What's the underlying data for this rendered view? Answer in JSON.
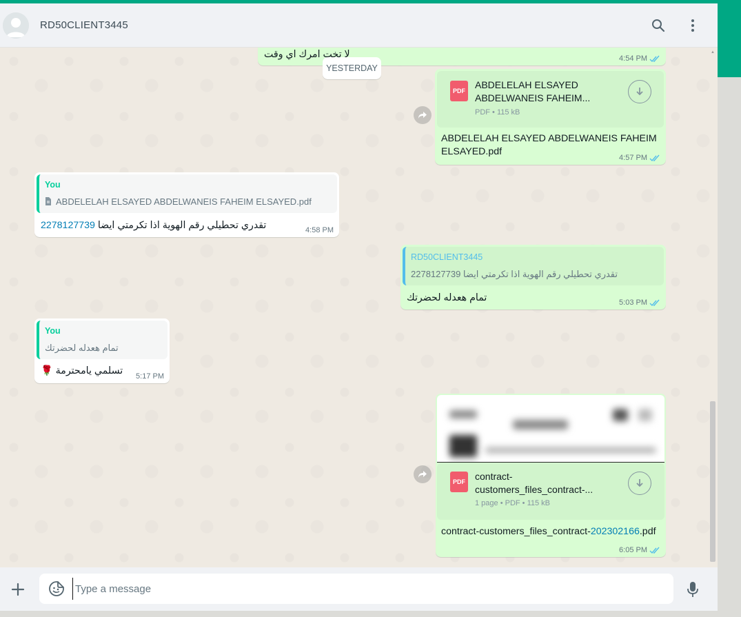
{
  "header": {
    "contact_name": "RD50CLIENT3445",
    "search_icon": "search-icon",
    "menu_icon": "kebab-menu-icon"
  },
  "date_divider": "YESTERDAY",
  "messages": {
    "m0": {
      "text": "لا تخت امرك اي وقت",
      "time": "4:54 PM"
    },
    "m1": {
      "doc_title_line1": "ABDELELAH ELSAYED",
      "doc_title_line2": "ABDELWANEIS FAHEIM...",
      "doc_meta": "PDF • 115 kB",
      "caption_line1": "ABDELELAH ELSAYED ABDELWANEIS FAHEIM",
      "caption_line2": "ELSAYED.pdf",
      "time": "4:57 PM"
    },
    "m2": {
      "quote_author": "You",
      "quote_text": "ABDELELAH ELSAYED ABDELWANEIS FAHEIM ELSAYED.pdf",
      "text": "تقدري تحطيلي رقم الهوية اذا تكرمتي ايضا",
      "number": "2278127739",
      "time": "4:58 PM"
    },
    "m3": {
      "quote_author": "RD50CLIENT3445",
      "quote_text": "تقدري تحطيلي رقم الهوية اذا تكرمتي ايضا 2278127739",
      "text": "تمام هعدله لحضرتك",
      "time": "5:03 PM"
    },
    "m4": {
      "quote_author": "You",
      "quote_text": "تمام هعدله لحضرتك",
      "text": "تسلمي يامحترمة 🌹",
      "time": "5:17 PM"
    },
    "m5": {
      "doc_title_line1": "contract-",
      "doc_title_line2": "customers_files_contract-...",
      "doc_meta": "1 page • PDF • 115 kB",
      "caption_prefix": "contract-customers_files_contract-",
      "caption_link": "202302166",
      "caption_suffix": ".pdf",
      "time": "6:05 PM"
    }
  },
  "pdf_badge": "PDF",
  "composer": {
    "placeholder": "Type a message"
  },
  "colors": {
    "accent": "#00a884",
    "outgoing_bubble": "#d9fdd3",
    "incoming_bubble": "#ffffff",
    "read_ticks": "#53bdeb",
    "link": "#027eb5"
  }
}
